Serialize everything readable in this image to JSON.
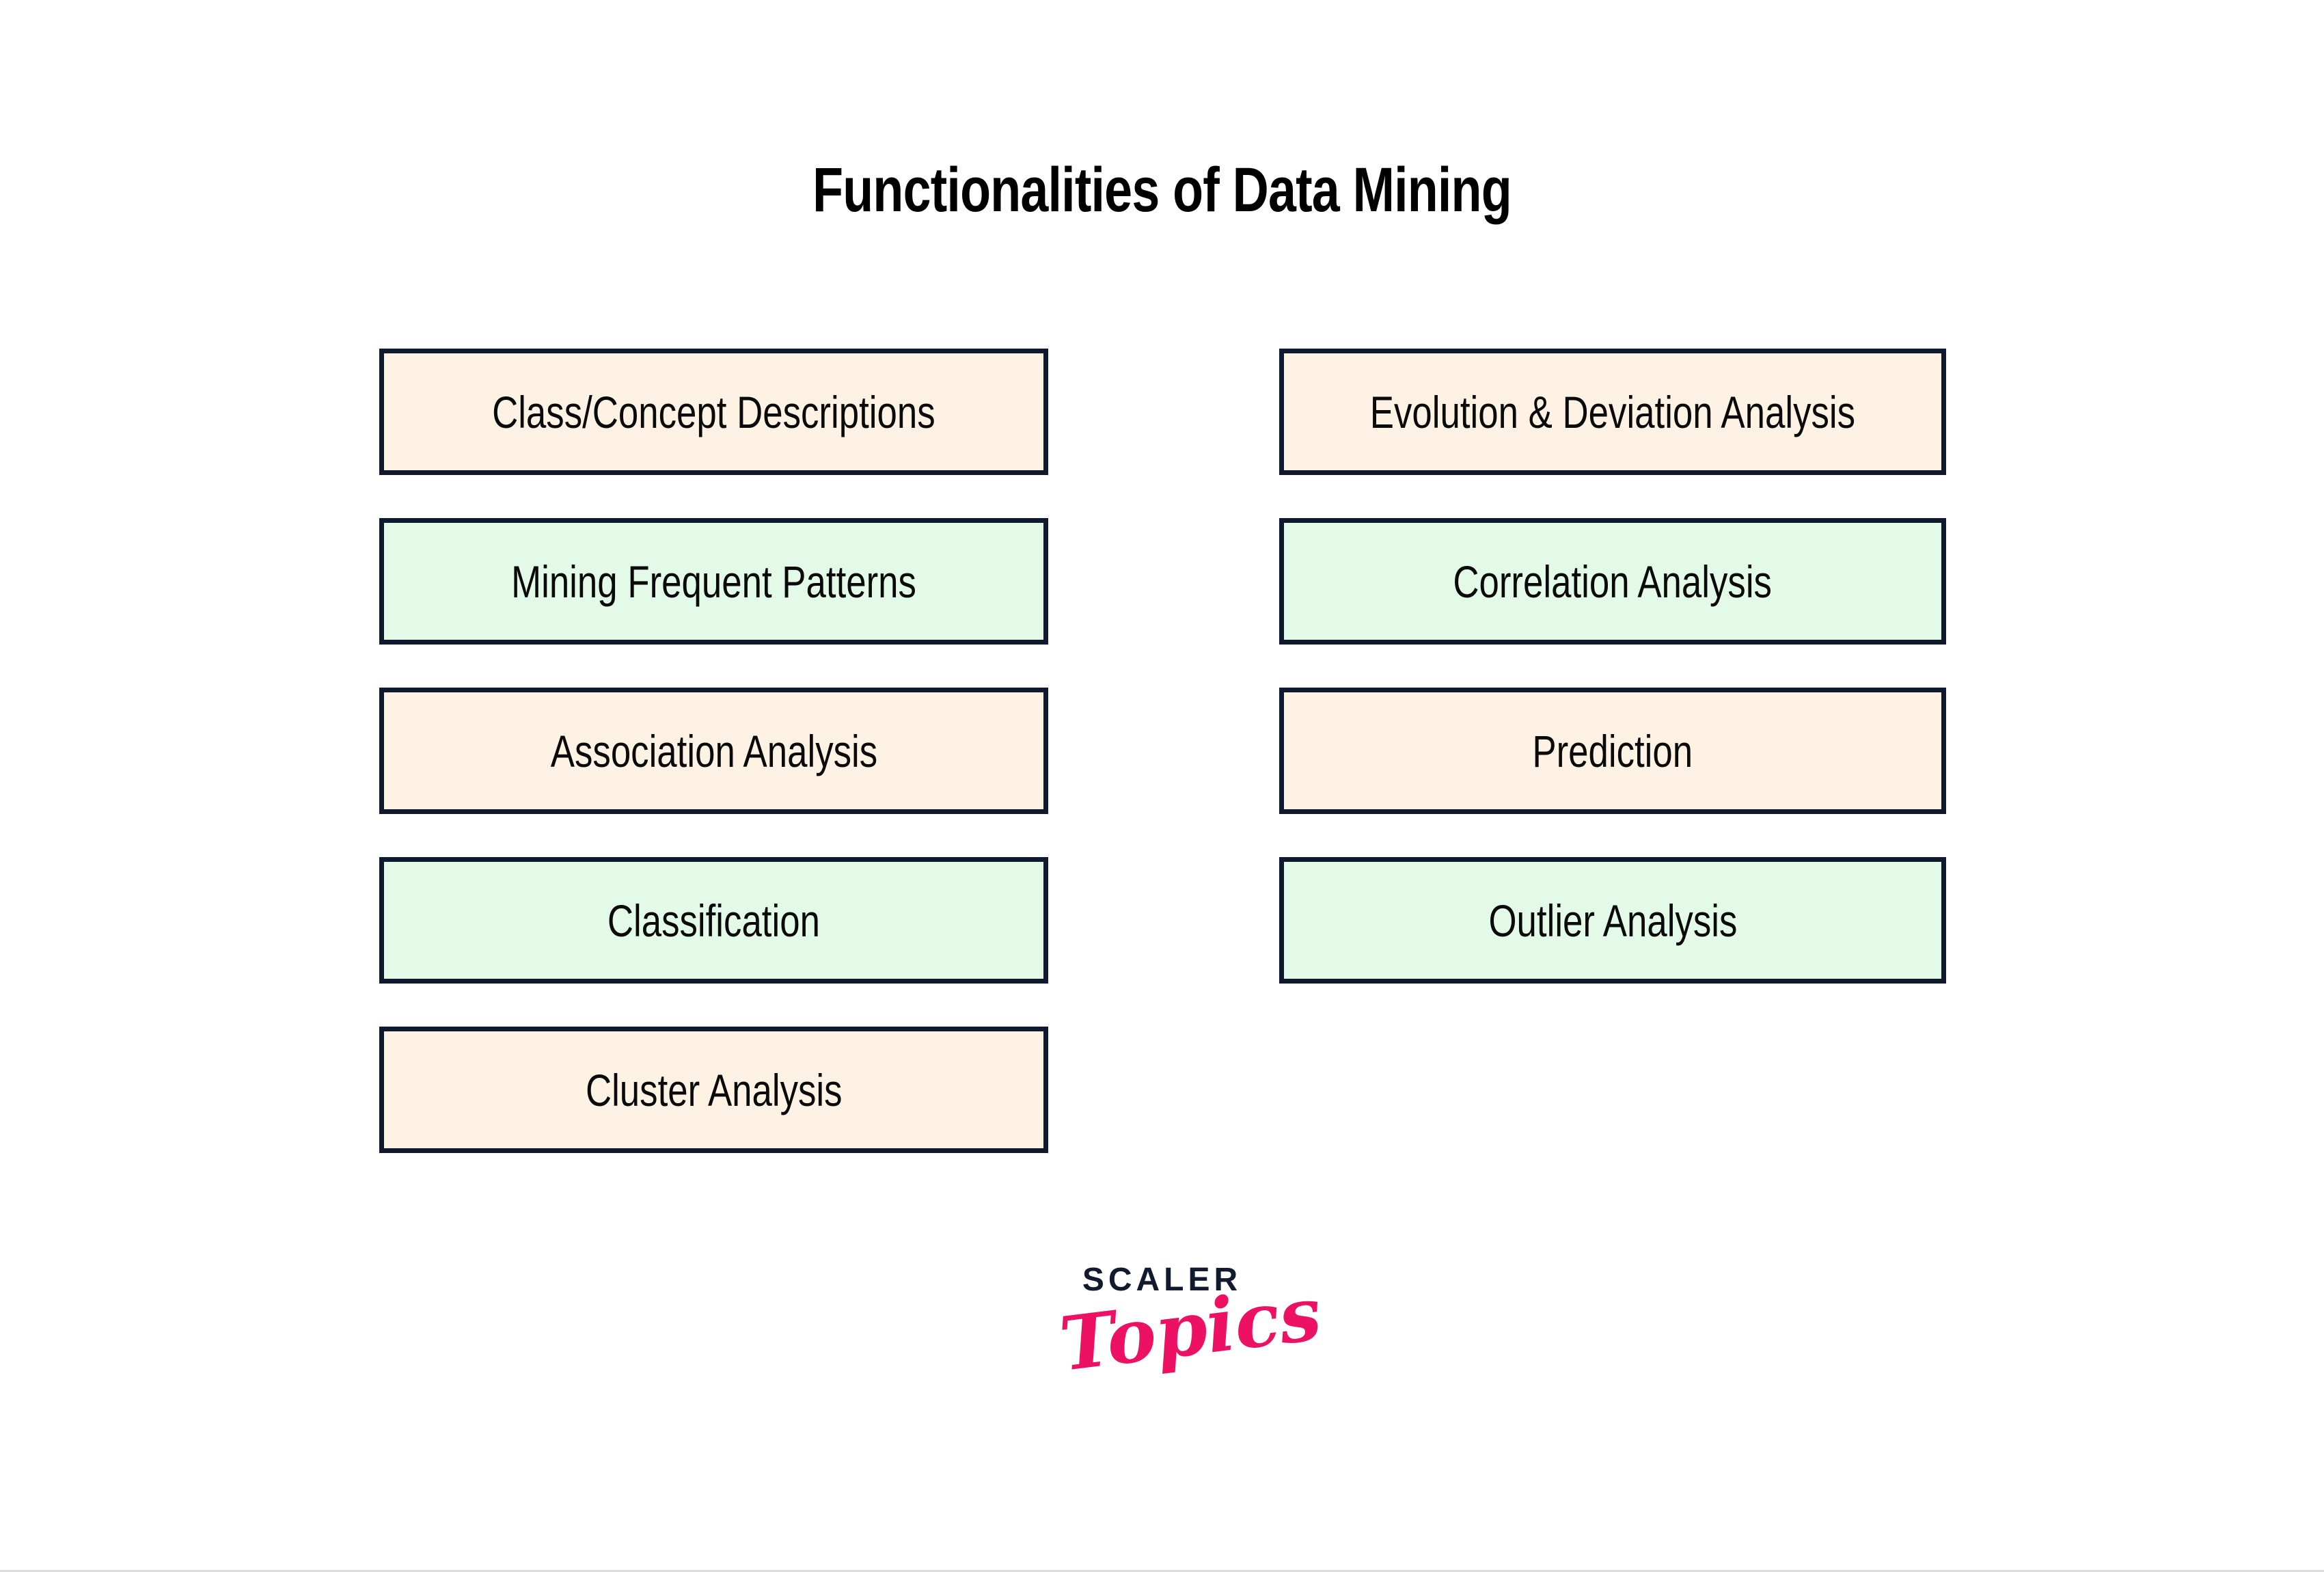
{
  "page": {
    "title": "Functionalities of Data Mining",
    "background_color": "#ffffff",
    "border_color": "#dcdcdc"
  },
  "colors": {
    "box_border": "#101a2e",
    "cream_fill": "#fdf2e4",
    "mint_fill": "#e3fae8",
    "text": "#0a0a0a",
    "logo_dark": "#121a2e",
    "logo_pink": "#ed1164"
  },
  "diagram": {
    "left_column": [
      {
        "label": "Class/Concept Descriptions",
        "fill": "cream"
      },
      {
        "label": "Mining Frequent Patterns",
        "fill": "mint"
      },
      {
        "label": "Association Analysis",
        "fill": "cream"
      },
      {
        "label": "Classification",
        "fill": "mint"
      },
      {
        "label": "Cluster Analysis",
        "fill": "cream"
      }
    ],
    "right_column": [
      {
        "label": "Evolution & Deviation Analysis",
        "fill": "cream"
      },
      {
        "label": "Correlation Analysis",
        "fill": "mint"
      },
      {
        "label": "Prediction",
        "fill": "cream"
      },
      {
        "label": "Outlier Analysis",
        "fill": "mint"
      }
    ]
  },
  "logo": {
    "primary": "SCALER",
    "secondary": "Topics"
  }
}
